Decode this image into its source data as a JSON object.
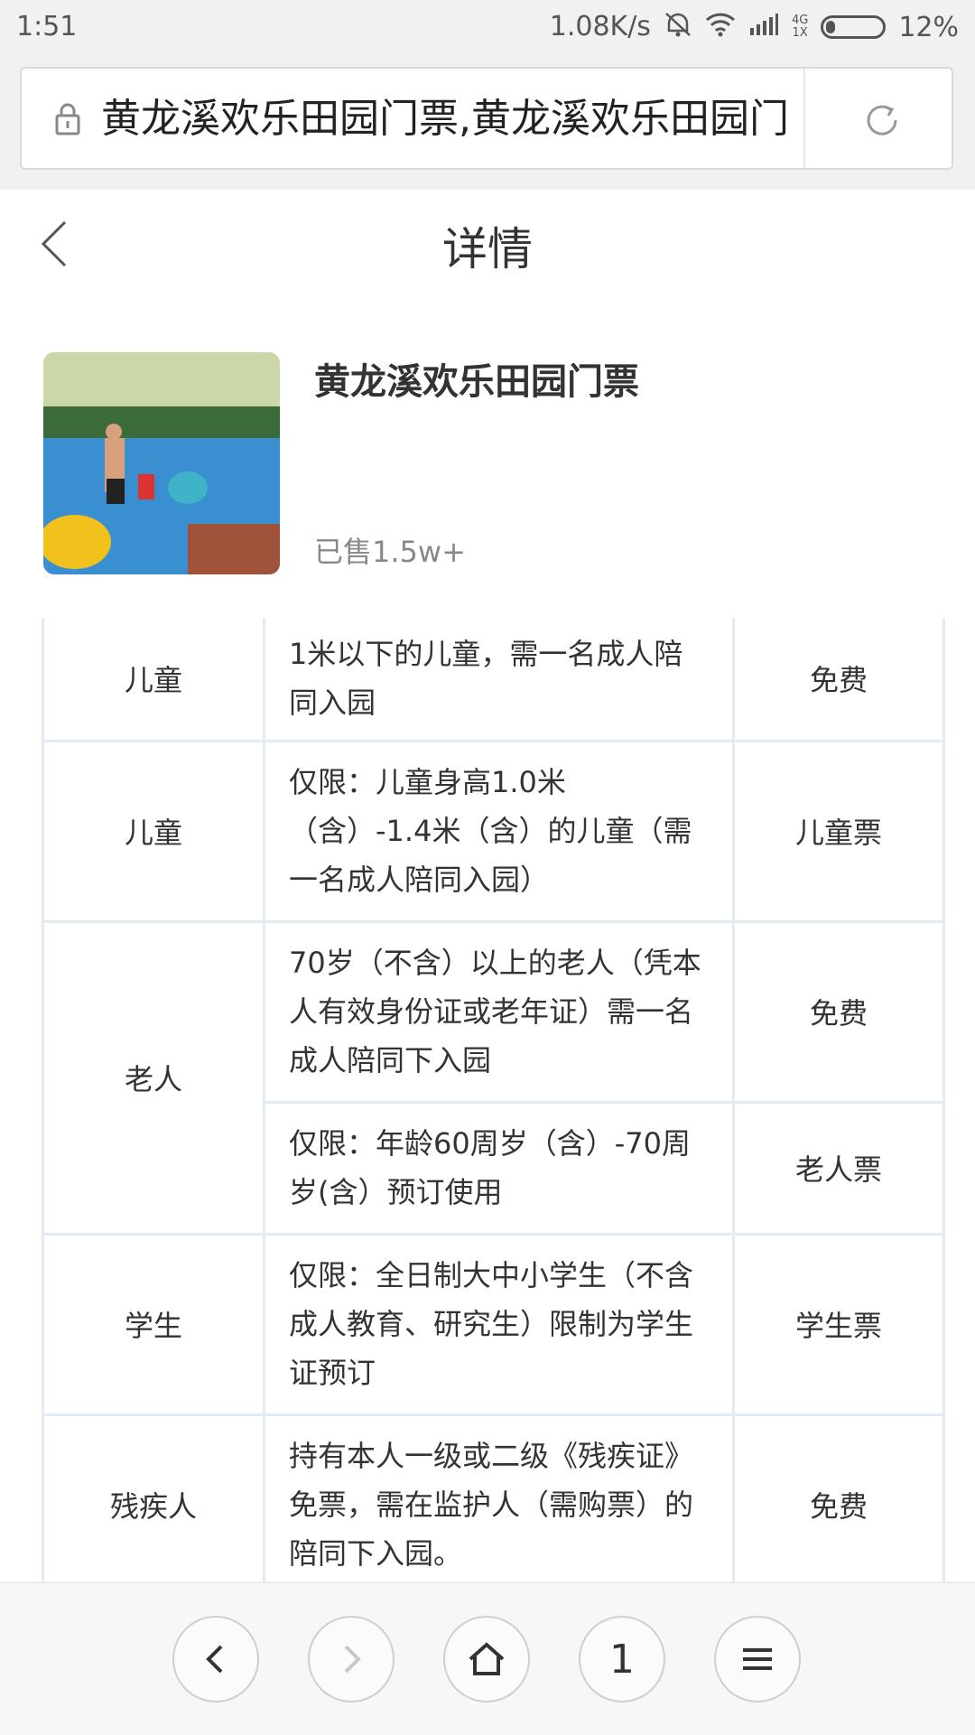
{
  "status_bar": {
    "time": "1:51",
    "speed": "1.08K/s",
    "network_top": "4G",
    "network_bottom": "1X",
    "battery": "12%"
  },
  "browser": {
    "url": "黄龙溪欢乐田园门票,黄龙溪欢乐田园门"
  },
  "header": {
    "title": "详情"
  },
  "product": {
    "name": "黄龙溪欢乐田园门票",
    "sold": "已售1.5w+"
  },
  "ticket_table": {
    "rows": [
      {
        "group": "儿童",
        "condition": "1米以下的儿童，需一名成人陪同入园",
        "ticket": "免费"
      },
      {
        "group": "儿童",
        "condition": "仅限：儿童身高1.0米（含）-1.4米（含）的儿童（需一名成人陪同入园）",
        "ticket": "儿童票"
      },
      {
        "group": "老人",
        "condition": "70岁（不含）以上的老人（凭本人有效身份证或老年证）需一名成人陪同下入园",
        "ticket": "免费"
      },
      {
        "group": "",
        "condition": "仅限：年龄60周岁（含）-70周岁(含）预订使用",
        "ticket": "老人票"
      },
      {
        "group": "学生",
        "condition": "仅限：全日制大中小学生（不含成人教育、研究生）限制为学生证预订",
        "ticket": "学生票"
      },
      {
        "group": "残疾人",
        "condition": "持有本人一级或二级《残疾证》免票，需在监护人（需购票）的陪同下入园。",
        "ticket": "免费"
      }
    ]
  },
  "bottom_nav": {
    "tab_count": "1"
  }
}
